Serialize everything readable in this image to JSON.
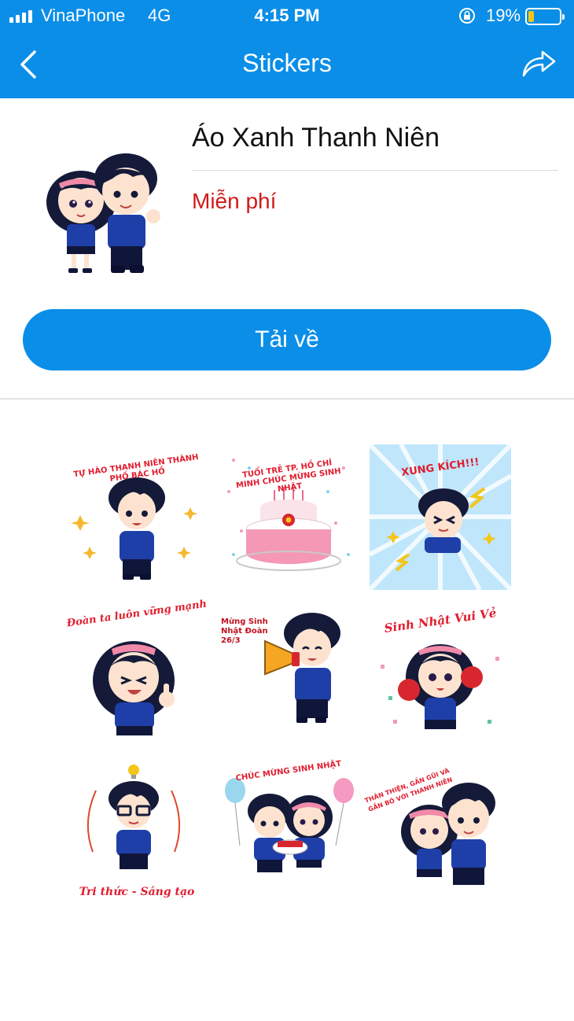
{
  "status_bar": {
    "carrier": "VinaPhone",
    "network": "4G",
    "time": "4:15 PM",
    "battery_percent": "19%",
    "battery_level": 0.19,
    "icons": [
      "signal-icon",
      "orientation-lock-icon",
      "battery-icon"
    ]
  },
  "nav": {
    "title": "Stickers",
    "back_icon": "chevron-left-icon",
    "share_icon": "share-arrow-icon"
  },
  "pack": {
    "title": "Áo Xanh Thanh Niên",
    "price": "Miễn phí",
    "download_label": "Tải về"
  },
  "stickers": [
    {
      "caption": "TỰ HÀO THANH NIÊN THÀNH PHỐ BÁC HỒ"
    },
    {
      "caption": "TUỔI TRẺ TP. HỒ CHÍ MINH CHÚC MỪNG SINH NHẬT"
    },
    {
      "caption": "XUNG KÍCH!!!"
    },
    {
      "caption": "Đoàn ta luôn vững mạnh"
    },
    {
      "caption": "Mừng Sinh Nhật Đoàn 26/3"
    },
    {
      "caption": "Sinh Nhật Vui Vẻ"
    },
    {
      "caption": "Tri thức - Sáng tạo"
    },
    {
      "caption": "CHÚC MỪNG SINH NHẬT"
    },
    {
      "caption": "THÂN THIỆN, GẦN GŨI VÀ GẮN BÓ VỚI THANH NIÊN"
    }
  ],
  "colors": {
    "accent": "#0a8ee8",
    "price": "#d11a1a",
    "shirt": "#1f3fa8",
    "hair": "#111a3a",
    "bow": "#f08aa8"
  }
}
